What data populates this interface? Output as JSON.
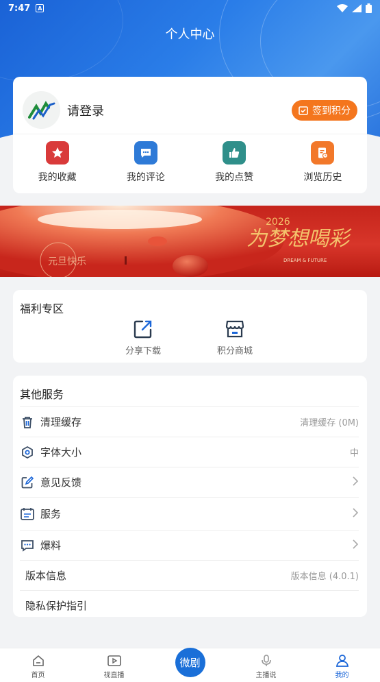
{
  "status_bar": {
    "time": "7:47",
    "badge": "A"
  },
  "header": {
    "title": "个人中心"
  },
  "login": {
    "prompt": "请登录",
    "sign_button": "签到积分"
  },
  "quick_actions": [
    {
      "label": "我的收藏",
      "icon": "star-icon",
      "color": "#d93a3a"
    },
    {
      "label": "我的评论",
      "icon": "comment-icon",
      "color": "#2e7ad7"
    },
    {
      "label": "我的点赞",
      "icon": "thumbs-up-icon",
      "color": "#2f8f8a"
    },
    {
      "label": "浏览历史",
      "icon": "history-icon",
      "color": "#f2782a"
    }
  ],
  "banner": {
    "headline": "为梦想喝彩",
    "year": "2026",
    "tagline": "DREAM & FUTURE",
    "stamp": "元旦快乐"
  },
  "welfare": {
    "title": "福利专区",
    "items": [
      {
        "label": "分享下载",
        "icon": "share-icon"
      },
      {
        "label": "积分商城",
        "icon": "store-icon"
      }
    ]
  },
  "other_services": {
    "title": "其他服务",
    "rows": [
      {
        "label": "清理缓存",
        "value": "清理缓存 (0M)",
        "icon": "trash-icon"
      },
      {
        "label": "字体大小",
        "value": "中",
        "icon": "font-size-icon"
      },
      {
        "label": "意见反馈",
        "value": "",
        "icon": "edit-icon"
      },
      {
        "label": "服务",
        "value": "",
        "icon": "service-icon"
      },
      {
        "label": "爆料",
        "value": "",
        "icon": "message-icon"
      },
      {
        "label": "版本信息",
        "value": "版本信息 (4.0.1)",
        "icon": ""
      },
      {
        "label": "隐私保护指引",
        "value": "",
        "icon": ""
      }
    ]
  },
  "tab_bar": [
    {
      "label": "首页",
      "icon": "home-icon"
    },
    {
      "label": "视直播",
      "icon": "play-icon"
    },
    {
      "label": "微剧",
      "icon": ""
    },
    {
      "label": "主播说",
      "icon": "mic-icon"
    },
    {
      "label": "我的",
      "icon": "user-icon"
    }
  ],
  "colors": {
    "primary": "#1b66d8",
    "accent": "#f4761e",
    "banner_red": "#c5241b"
  }
}
